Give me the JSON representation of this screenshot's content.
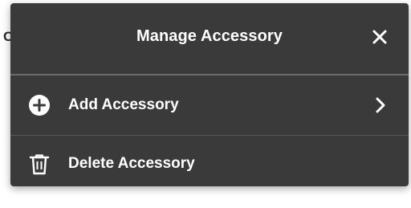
{
  "background": {
    "clipped_text": "C"
  },
  "dialog": {
    "title": "Manage Accessory",
    "close_icon": "close-icon",
    "items": [
      {
        "label": "Add Accessory",
        "icon": "plus-circle-icon",
        "trailing_icon": "chevron-right-icon"
      },
      {
        "label": "Delete Accessory",
        "icon": "trash-icon"
      }
    ]
  },
  "colors": {
    "panel": "#3a3a3a",
    "text": "#ffffff",
    "divider": "#6a6a6a"
  }
}
